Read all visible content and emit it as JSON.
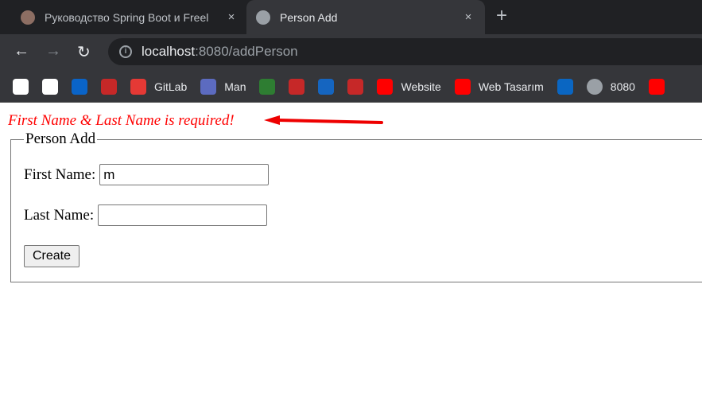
{
  "browser": {
    "tabs": [
      {
        "title": "Руководство Spring Boot и Freel",
        "active": false
      },
      {
        "title": "Person Add",
        "active": true
      }
    ],
    "new_tab": "+",
    "close": "×",
    "url_host": "localhost",
    "url_rest": ":8080/addPerson",
    "bookmarks": [
      {
        "icon": "google-icon",
        "label": ""
      },
      {
        "icon": "gmail-icon",
        "label": ""
      },
      {
        "icon": "outlook-icon",
        "label": ""
      },
      {
        "icon": "bookmark-icon",
        "label": ""
      },
      {
        "icon": "gitlab-icon",
        "label": "GitLab"
      },
      {
        "icon": "lock-icon",
        "label": "Man"
      },
      {
        "icon": "star-icon",
        "label": ""
      },
      {
        "icon": "bookmark-icon",
        "label": ""
      },
      {
        "icon": "hd-icon",
        "label": ""
      },
      {
        "icon": "bookmark-icon",
        "label": ""
      },
      {
        "icon": "youtube-icon",
        "label": "Website"
      },
      {
        "icon": "youtube-icon",
        "label": "Web Tasarım"
      },
      {
        "icon": "linkedin-icon",
        "label": ""
      },
      {
        "icon": "globe-icon",
        "label": "8080"
      },
      {
        "icon": "youtube-icon",
        "label": ""
      }
    ]
  },
  "page": {
    "error": "First Name & Last Name is required!",
    "legend": "Person Add",
    "first_name_label": "First Name:",
    "first_name_value": "m",
    "last_name_label": "Last Name:",
    "last_name_value": "",
    "create_label": "Create",
    "error_color": "#ff0000"
  }
}
